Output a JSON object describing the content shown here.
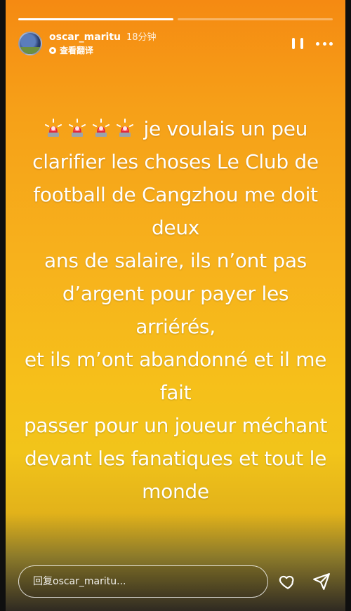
{
  "story": {
    "progress": {
      "segments": 2,
      "active_fill_percent": 100
    },
    "header": {
      "username": "oscar_maritu",
      "time_ago": "18分钟",
      "translate_label": "查看翻译"
    },
    "text_lines": [
      "je voulais un peu",
      "clarifier les choses Le Club de",
      "football de Cangzhou  me doit deux",
      "ans de salaire, ils n’ont pas",
      "d’argent pour payer les arriérés,",
      "et ils m’ont abandonné et il me fait",
      "passer pour un joueur méchant",
      "devant les fanatiques et tout le",
      "monde"
    ],
    "emoji": {
      "name": "police-car-light",
      "count": 4
    },
    "reply": {
      "placeholder": "回复oscar_maritu..."
    },
    "icons": {
      "pause": "pause-icon",
      "more": "more-icon",
      "heart": "heart-icon",
      "send": "send-icon"
    },
    "colors": {
      "gradient_top": "#f58a12",
      "gradient_mid": "#f7b11c",
      "gradient_bottom": "#2f2a22",
      "text": "#ffffff"
    }
  }
}
